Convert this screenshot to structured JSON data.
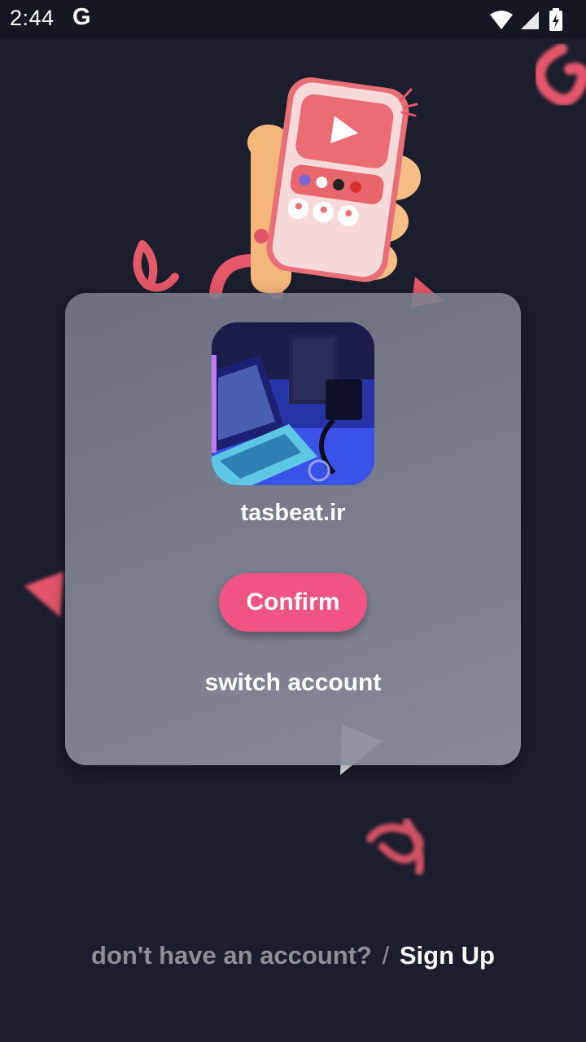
{
  "status_bar": {
    "time": "2:44",
    "g_label": "G",
    "icons": [
      "wifi-icon",
      "cell-signal-icon",
      "battery-charging-icon"
    ]
  },
  "login": {
    "account_name": "tasbeat.ir",
    "confirm_label": "Confirm",
    "switch_label": "switch account"
  },
  "footer": {
    "prompt": "don't have an account?",
    "separator": "/",
    "signup_label": "Sign Up"
  },
  "colors": {
    "background": "#1c1e2d",
    "accent": "#ef5484",
    "card": "#80838f"
  }
}
